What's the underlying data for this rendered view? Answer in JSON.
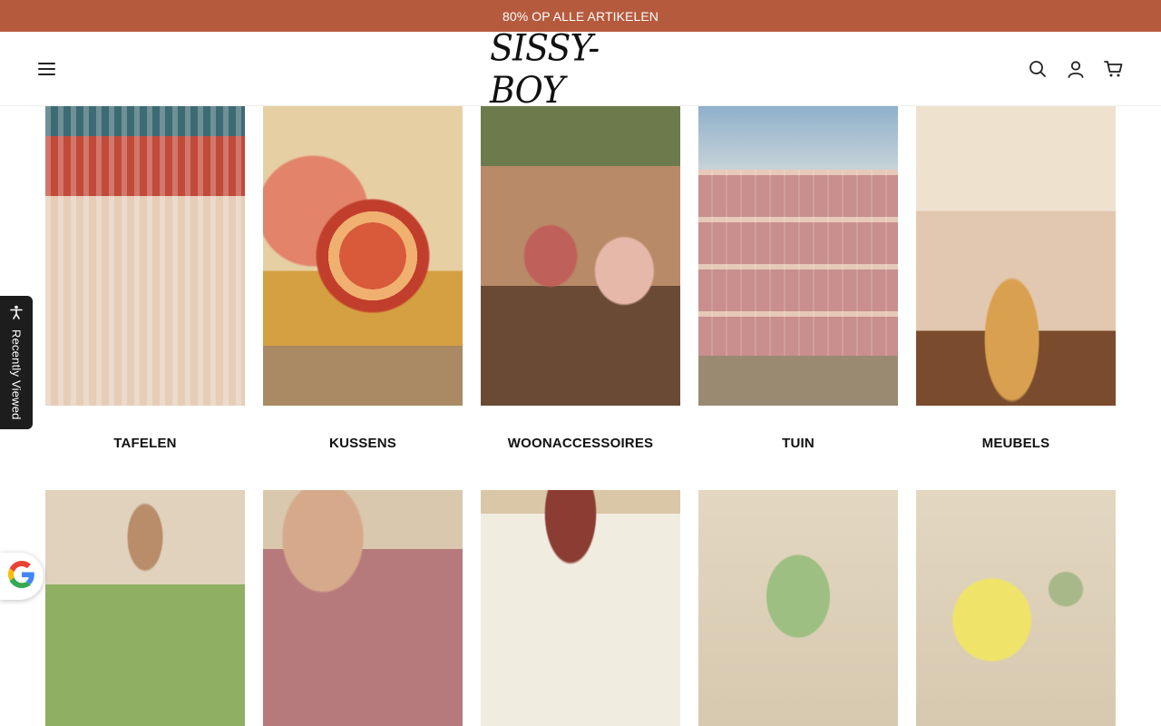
{
  "promo": {
    "text": "80% OP ALLE ARTIKELEN"
  },
  "header": {
    "logo": "SISSY-BOY",
    "icons": [
      "menu-icon",
      "search-icon",
      "account-icon",
      "cart-icon"
    ]
  },
  "categories": [
    {
      "label": "TAFELEN"
    },
    {
      "label": "KUSSENS"
    },
    {
      "label": "WOONACCESSOIRES"
    },
    {
      "label": "TUIN"
    },
    {
      "label": "MEUBELS"
    }
  ],
  "recently_viewed": {
    "label": "Recently Viewed"
  },
  "colors": {
    "promo_bg": "#b65a3d",
    "tab_bg": "#1d1d1d"
  }
}
